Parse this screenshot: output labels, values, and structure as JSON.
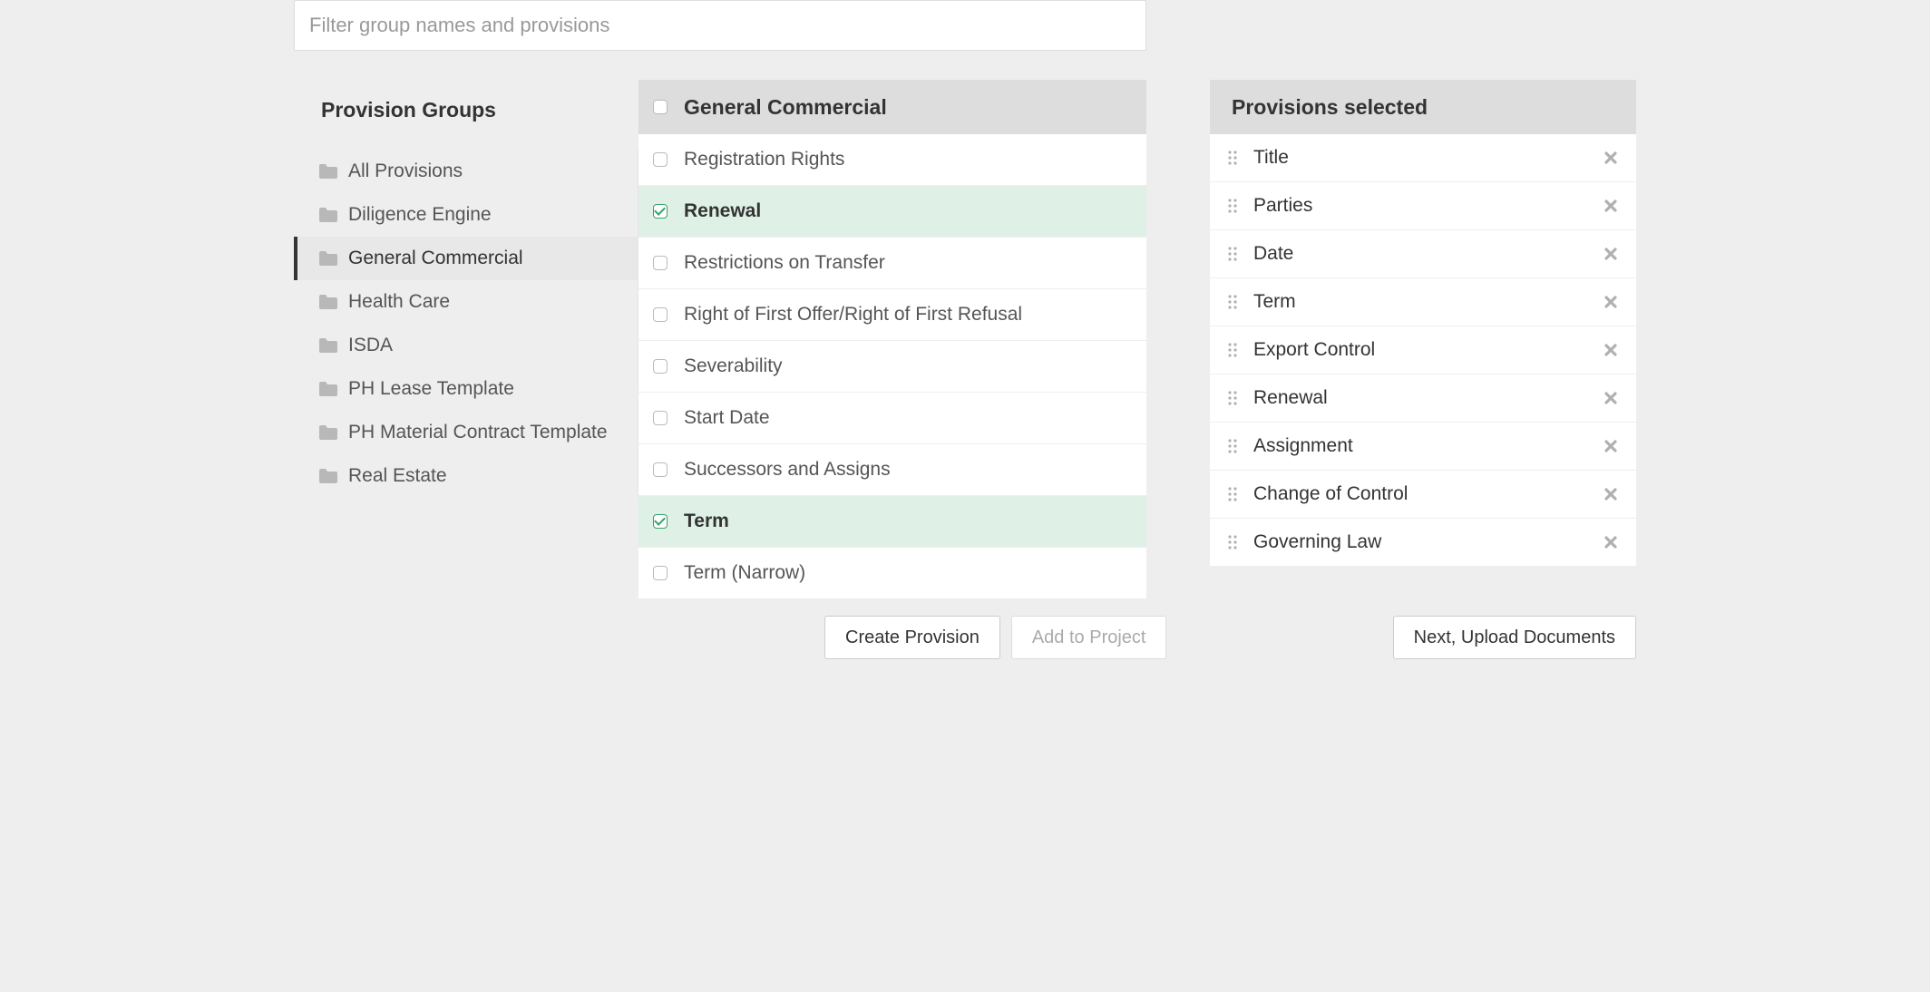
{
  "filter": {
    "placeholder": "Filter group names and provisions"
  },
  "groups": {
    "title": "Provision Groups",
    "items": [
      {
        "label": "All Provisions",
        "active": false
      },
      {
        "label": "Diligence Engine",
        "active": false
      },
      {
        "label": "General Commercial",
        "active": true
      },
      {
        "label": "Health Care",
        "active": false
      },
      {
        "label": "ISDA",
        "active": false
      },
      {
        "label": "PH Lease Template",
        "active": false
      },
      {
        "label": "PH Material Contract Template",
        "active": false
      },
      {
        "label": "Real Estate",
        "active": false
      }
    ]
  },
  "provisions": {
    "header": "General Commercial",
    "items": [
      {
        "label": "Registration Rights",
        "checked": false
      },
      {
        "label": "Renewal",
        "checked": true
      },
      {
        "label": "Restrictions on Transfer",
        "checked": false
      },
      {
        "label": "Right of First Offer/Right of First Refusal",
        "checked": false
      },
      {
        "label": "Severability",
        "checked": false
      },
      {
        "label": "Start Date",
        "checked": false
      },
      {
        "label": "Successors and Assigns",
        "checked": false
      },
      {
        "label": "Term",
        "checked": true
      },
      {
        "label": "Term (Narrow)",
        "checked": false
      }
    ]
  },
  "selected": {
    "header": "Provisions selected",
    "items": [
      {
        "label": "Title"
      },
      {
        "label": "Parties"
      },
      {
        "label": "Date"
      },
      {
        "label": "Term"
      },
      {
        "label": "Export Control"
      },
      {
        "label": "Renewal"
      },
      {
        "label": "Assignment"
      },
      {
        "label": "Change of Control"
      },
      {
        "label": "Governing Law"
      }
    ]
  },
  "buttons": {
    "create": "Create Provision",
    "add": "Add to Project",
    "next": "Next, Upload Documents"
  }
}
